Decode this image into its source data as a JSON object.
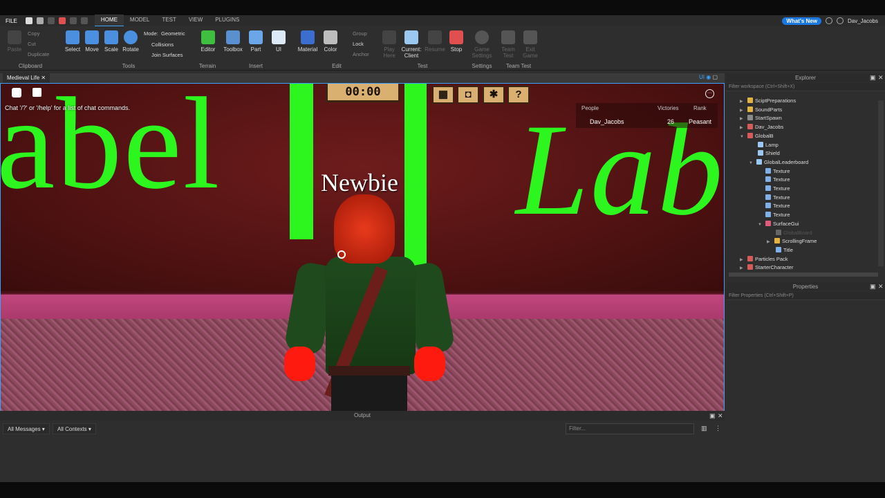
{
  "menu": {
    "file": "FILE",
    "tabs": [
      "HOME",
      "MODEL",
      "TEST",
      "VIEW",
      "PLUGINS"
    ],
    "active_tab": "HOME",
    "whats_new": "What's New",
    "user": "Dav_Jacobs"
  },
  "ribbon": {
    "clipboard": {
      "label": "Clipboard",
      "items": [
        "Paste",
        "Copy",
        "Cut",
        "Duplicate"
      ]
    },
    "tools": {
      "label": "Tools",
      "items": [
        "Select",
        "Move",
        "Scale",
        "Rotate"
      ],
      "mode_label": "Mode:",
      "mode_value": "Geometric",
      "collisions": "Collisions",
      "join_surfaces": "Join Surfaces"
    },
    "terrain": {
      "label": "Terrain",
      "editor": "Editor"
    },
    "insert": {
      "label": "Insert",
      "items": [
        "Toolbox",
        "Part",
        "UI"
      ]
    },
    "edit": {
      "label": "Edit",
      "items": [
        "Material",
        "Color"
      ],
      "group": "Group",
      "lock": "Lock",
      "anchor": "Anchor"
    },
    "test": {
      "label": "Test",
      "play_here": "Play Here",
      "current_client": "Current: Client",
      "resume": "Resume",
      "stop": "Stop"
    },
    "settings": {
      "label": "Settings",
      "game_settings": "Game Settings"
    },
    "team_test": {
      "label": "Team Test",
      "team_test": "Team Test",
      "exit_game": "Exit Game"
    }
  },
  "viewport": {
    "tab_title": "Medieval Life",
    "ui_toggle": "UI",
    "timer": "00:00",
    "chat_hint": "Chat '/?' or '/help' for a list of chat commands.",
    "sign_left": "abel",
    "sign_right": "Lab",
    "nametag": "Newbie",
    "hud_buttons": [
      "cart-icon",
      "backpack-icon",
      "gear-icon",
      "help-icon"
    ],
    "help_glyph": "?",
    "leaderboard": {
      "headers": [
        "People",
        "Victories",
        "Rank"
      ],
      "rows": [
        {
          "name": "Dav_Jacobs",
          "victories": "26",
          "rank": "Peasant"
        }
      ]
    }
  },
  "output": {
    "title": "Output",
    "messages_filter": "All Messages",
    "contexts_filter": "All Contexts",
    "filter_placeholder": "Filter..."
  },
  "explorer": {
    "title": "Explorer",
    "filter": "Filter workspace (Ctrl+Shift+X)",
    "items": [
      {
        "label": "SciptPreparations",
        "icon": "folder-icon",
        "color": "#e3b341",
        "indent": 0,
        "expand": "▶"
      },
      {
        "label": "SoundParts",
        "icon": "folder-icon",
        "color": "#e3b341",
        "indent": 0,
        "expand": "▶"
      },
      {
        "label": "StartSpawn",
        "icon": "spawn-icon",
        "color": "#8a8a8a",
        "indent": 0,
        "expand": "▶"
      },
      {
        "label": "Dav_Jacobs",
        "icon": "model-icon",
        "color": "#d65a5a",
        "indent": 0,
        "expand": "▶"
      },
      {
        "label": "GlobalB",
        "icon": "model-icon",
        "color": "#d65a5a",
        "indent": 0,
        "expand": "▼"
      },
      {
        "label": "Lamp",
        "icon": "part-icon",
        "color": "#9ac8f0",
        "indent": 1,
        "expand": ""
      },
      {
        "label": "Shield",
        "icon": "part-icon",
        "color": "#9ac8f0",
        "indent": 1,
        "expand": ""
      },
      {
        "label": "GlobalLeaderboard",
        "icon": "part-icon",
        "color": "#9ac8f0",
        "indent": 1,
        "expand": "▼"
      },
      {
        "label": "Texture",
        "icon": "texture-icon",
        "color": "#7fb0e8",
        "indent": 2,
        "expand": ""
      },
      {
        "label": "Texture",
        "icon": "texture-icon",
        "color": "#7fb0e8",
        "indent": 2,
        "expand": ""
      },
      {
        "label": "Texture",
        "icon": "texture-icon",
        "color": "#7fb0e8",
        "indent": 2,
        "expand": ""
      },
      {
        "label": "Texture",
        "icon": "texture-icon",
        "color": "#7fb0e8",
        "indent": 2,
        "expand": ""
      },
      {
        "label": "Texture",
        "icon": "texture-icon",
        "color": "#7fb0e8",
        "indent": 2,
        "expand": ""
      },
      {
        "label": "Texture",
        "icon": "texture-icon",
        "color": "#7fb0e8",
        "indent": 2,
        "expand": ""
      },
      {
        "label": "SurfaceGui",
        "icon": "gui-icon",
        "color": "#e05a7a",
        "indent": 2,
        "expand": "▼"
      },
      {
        "label": "GlobalBoard",
        "icon": "frame-icon",
        "color": "#666666",
        "indent": 3,
        "expand": "",
        "dim": true
      },
      {
        "label": "ScrollingFrame",
        "icon": "frame-icon",
        "color": "#e3b341",
        "indent": 3,
        "expand": "▶"
      },
      {
        "label": "Title",
        "icon": "text-icon",
        "color": "#7fb0e8",
        "indent": 3,
        "expand": ""
      },
      {
        "label": "Particles Pack",
        "icon": "model-icon",
        "color": "#d65a5a",
        "indent": 0,
        "expand": "▶"
      },
      {
        "label": "StarterCharacter",
        "icon": "model-icon",
        "color": "#d65a5a",
        "indent": 0,
        "expand": "▶"
      }
    ]
  },
  "properties": {
    "title": "Properties",
    "filter": "Filter Properties (Ctrl+Shift+P)"
  },
  "colors": {
    "accent": "#3ba3ff",
    "sign_green": "#2df51e",
    "hud_gold": "#d9b070",
    "stop_red": "#e05050"
  }
}
